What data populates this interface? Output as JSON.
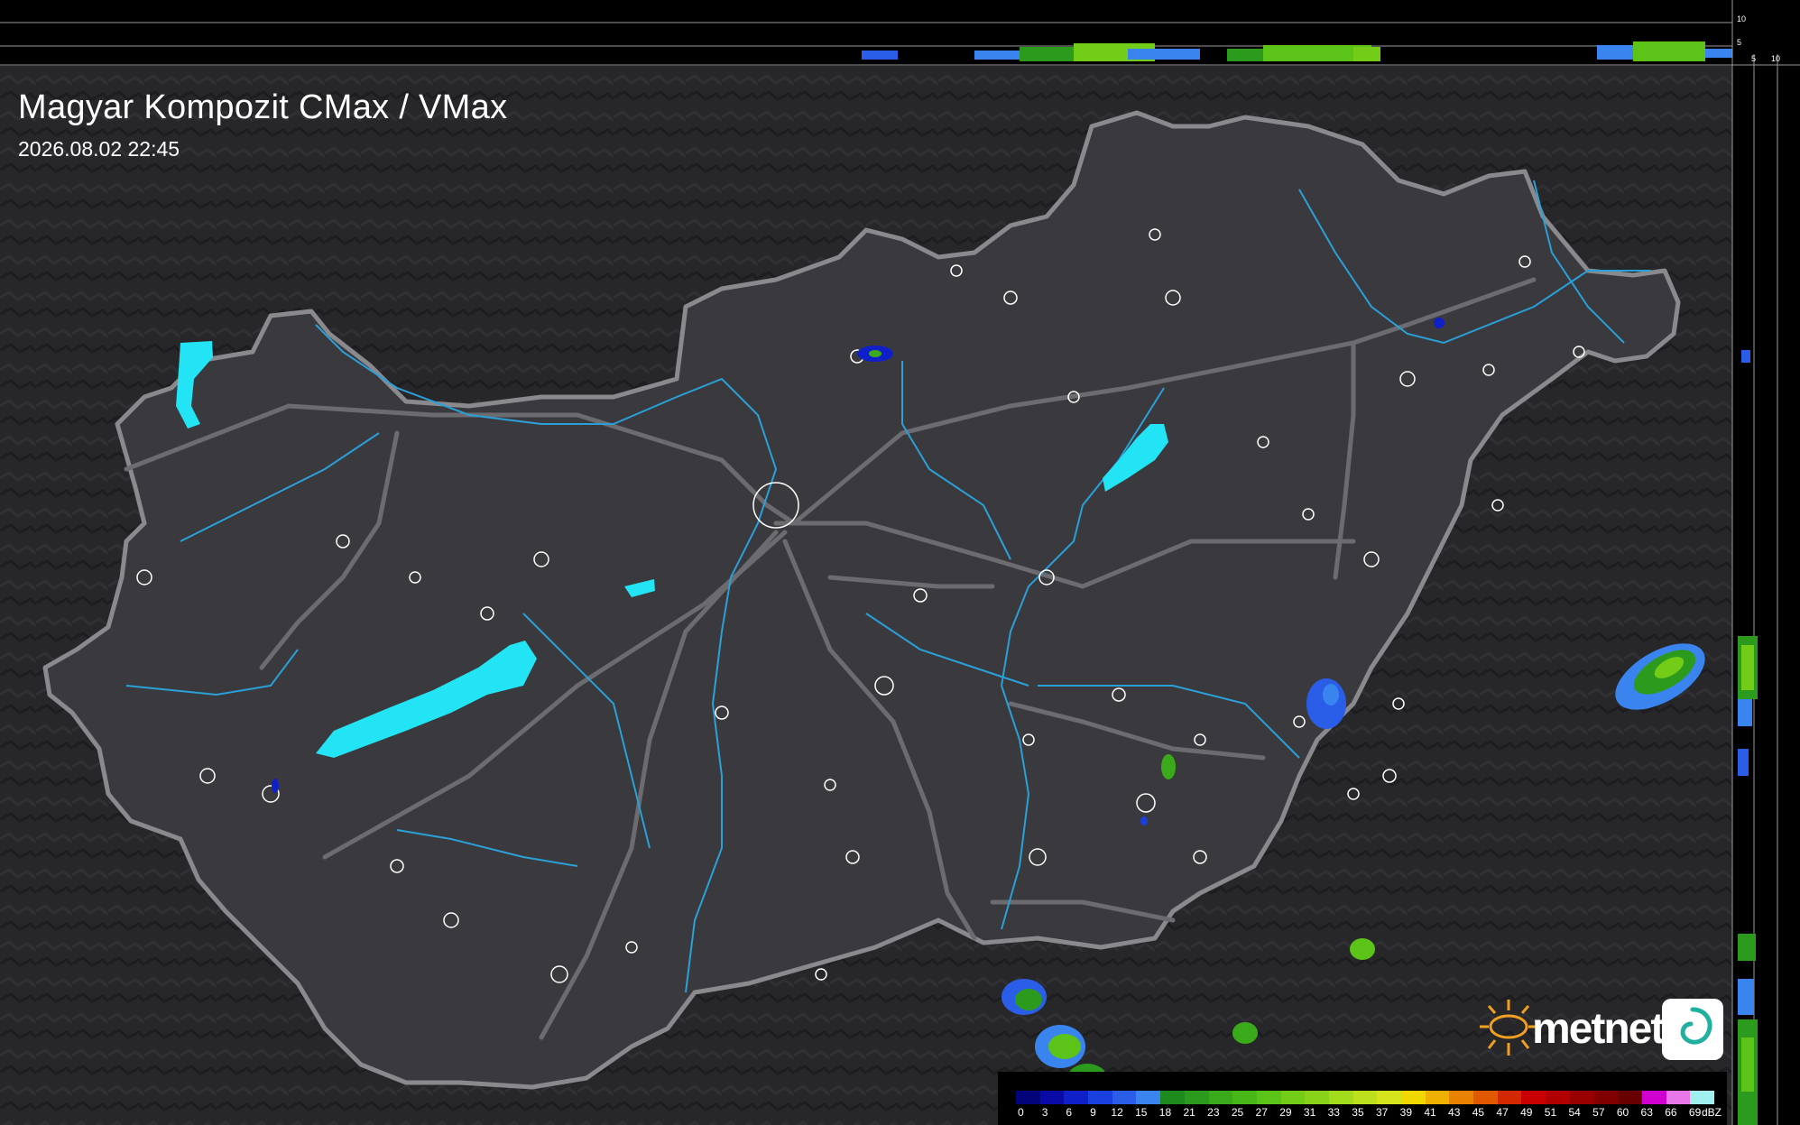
{
  "title": "Magyar Kompozit CMax / VMax",
  "timestamp": "2026.08.02 22:45",
  "logo": {
    "text": "metnet"
  },
  "profile_ticks": {
    "top_10": "10",
    "top_5": "5",
    "right_5": "5",
    "right_10": "10"
  },
  "legend": {
    "unit": "dBZ",
    "labels": [
      "0",
      "3",
      "6",
      "9",
      "12",
      "15",
      "18",
      "21",
      "23",
      "25",
      "27",
      "29",
      "31",
      "33",
      "35",
      "37",
      "39",
      "41",
      "43",
      "45",
      "47",
      "49",
      "51",
      "54",
      "57",
      "60",
      "63",
      "66",
      "69"
    ],
    "colors": [
      "#04047a",
      "#0a0aa6",
      "#1020c8",
      "#1a40e0",
      "#2a5ee8",
      "#3a84f0",
      "#1e8a1e",
      "#2c9a1c",
      "#3aaa1a",
      "#48b818",
      "#5cc418",
      "#72cc18",
      "#8ad21a",
      "#a2da1c",
      "#bce01e",
      "#d6e41e",
      "#f0d800",
      "#f0b000",
      "#e88200",
      "#e05800",
      "#d42800",
      "#c80000",
      "#b00000",
      "#980000",
      "#800000",
      "#680000",
      "#d000d0",
      "#e878e8",
      "#a0f0f0"
    ]
  },
  "colors": {
    "background": "#232326",
    "country_fill": "#3a3a3e",
    "border": "#8a8a8e",
    "roads": "#6c6c70",
    "rivers": "#2aa0d8",
    "lakes": "#22e4f4",
    "towns": "#ffffff"
  }
}
